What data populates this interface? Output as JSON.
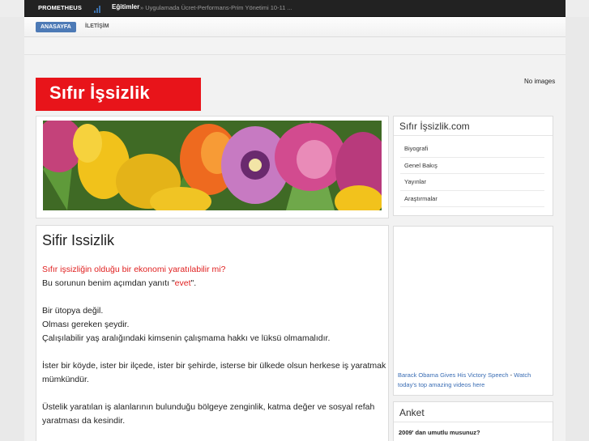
{
  "topbar": {
    "brand": "PROMETHEUS",
    "ticker_title": "Eğitimler",
    "ticker_text": "» Uygulamada Ücret-Performans-Prim Yönetimi 10-11 ..."
  },
  "nav": {
    "home": "ANASAYFA",
    "contact": "İLETİŞİM"
  },
  "header": {
    "logo_text": "Sıfır İşsizlik",
    "no_images": "No images"
  },
  "content": {
    "title": "Sifir Issizlik",
    "lines": [
      "Sıfır işsizliğin olduğu bir ekonomi yaratılabilir mi?",
      "Bu sorunun benim açımdan yanıtı ",
      "evet",
      "\".",
      "Bir ütopya değil.",
      "Olması gereken şeydir.",
      "Çalışılabilir yaş aralığındaki kimsenin çalışmama hakkı ve lüksü olmamalıdır.",
      "İster bir köyde, ister bir ilçede, ister bir şehirde, isterse bir ülkede olsun herkese iş yaratmak",
      "mümkündür.",
      "Üstelik yaratılan iş alanlarının bulunduğu bölgeye zenginlik, katma değer ve sosyal refah",
      "yaratması da kesindir."
    ]
  },
  "sidebar": {
    "title": "Sıfır İşsizlik.com",
    "items": [
      "Biyografi",
      "Genel Bakış",
      "Yayınlar",
      "Araştırmalar"
    ],
    "video_link": "Barack Obama Gives His Victory Speech",
    "video_sep": " - ",
    "video_more": "Watch today's top amazing videos here"
  },
  "poll": {
    "title": "Anket",
    "question": "2009' dan umutlu musunuz?"
  },
  "colors": {
    "logo_red": "#e8141a",
    "nav_blue": "#4d7ab6",
    "link_blue": "#3a6db4",
    "accent_red": "#e02020"
  }
}
